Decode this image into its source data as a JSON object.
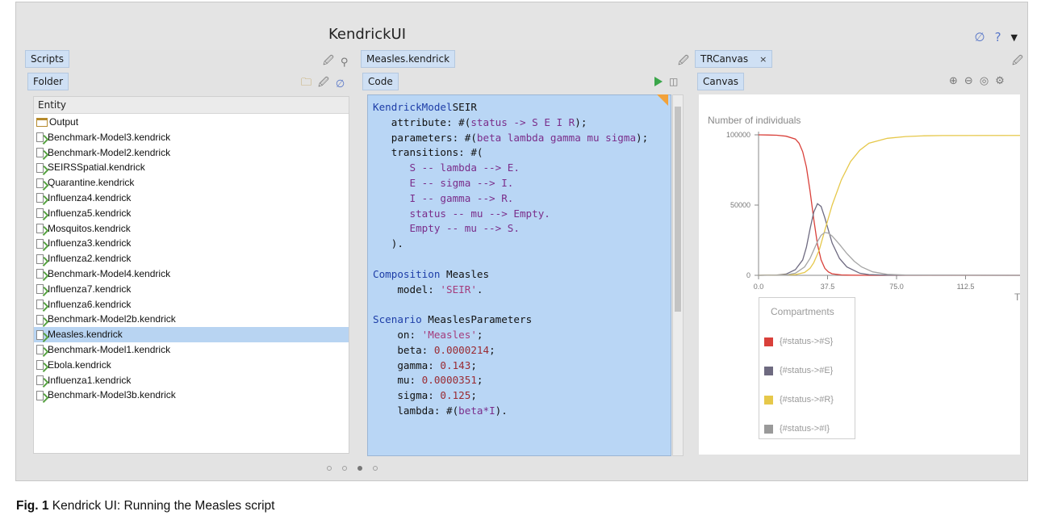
{
  "app": {
    "title": "KendrickUI"
  },
  "left_pane": {
    "tab": "Scripts",
    "subtab": "Folder",
    "column_header": "Entity",
    "items": [
      {
        "label": "Output",
        "kind": "folder"
      },
      {
        "label": "Benchmark-Model3.kendrick",
        "kind": "file"
      },
      {
        "label": "Benchmark-Model2.kendrick",
        "kind": "file"
      },
      {
        "label": "SEIRSSpatial.kendrick",
        "kind": "file"
      },
      {
        "label": "Quarantine.kendrick",
        "kind": "file"
      },
      {
        "label": "Influenza4.kendrick",
        "kind": "file"
      },
      {
        "label": "Influenza5.kendrick",
        "kind": "file"
      },
      {
        "label": "Mosquitos.kendrick",
        "kind": "file"
      },
      {
        "label": "Influenza3.kendrick",
        "kind": "file"
      },
      {
        "label": "Influenza2.kendrick",
        "kind": "file"
      },
      {
        "label": "Benchmark-Model4.kendrick",
        "kind": "file"
      },
      {
        "label": "Influenza7.kendrick",
        "kind": "file"
      },
      {
        "label": "Influenza6.kendrick",
        "kind": "file"
      },
      {
        "label": "Benchmark-Model2b.kendrick",
        "kind": "file"
      },
      {
        "label": "Measles.kendrick",
        "kind": "file",
        "selected": true
      },
      {
        "label": "Benchmark-Model1.kendrick",
        "kind": "file"
      },
      {
        "label": "Ebola.kendrick",
        "kind": "file"
      },
      {
        "label": "Influenza1.kendrick",
        "kind": "file"
      },
      {
        "label": "Benchmark-Model3b.kendrick",
        "kind": "file"
      }
    ]
  },
  "middle_pane": {
    "tab": "Measles.kendrick",
    "subtab": "Code",
    "code_lines": [
      [
        [
          "kw",
          "KendrickModel"
        ],
        [
          "",
          "SEIR"
        ]
      ],
      [
        [
          "",
          "   attribute: #("
        ],
        [
          "sym",
          "status -> S E I R"
        ],
        [
          "",
          ");"
        ]
      ],
      [
        [
          "",
          "   parameters: #("
        ],
        [
          "sym",
          "beta lambda gamma mu sigma"
        ],
        [
          "",
          ");"
        ]
      ],
      [
        [
          "",
          "   transitions: #("
        ]
      ],
      [
        [
          "sym",
          "      S -- lambda --> E."
        ]
      ],
      [
        [
          "sym",
          "      E -- sigma --> I."
        ]
      ],
      [
        [
          "sym",
          "      I -- gamma --> R."
        ]
      ],
      [
        [
          "sym",
          "      status -- mu --> Empty."
        ]
      ],
      [
        [
          "sym",
          "      Empty -- mu --> S."
        ]
      ],
      [
        [
          "",
          "   )."
        ]
      ],
      [
        [
          "",
          ""
        ]
      ],
      [
        [
          "kw",
          "Composition"
        ],
        [
          "",
          " Measles"
        ]
      ],
      [
        [
          "",
          "    model: "
        ],
        [
          "str",
          "'SEIR'"
        ],
        [
          "",
          "."
        ]
      ],
      [
        [
          "",
          ""
        ]
      ],
      [
        [
          "kw",
          "Scenario"
        ],
        [
          "",
          " MeaslesParameters"
        ]
      ],
      [
        [
          "",
          "    on: "
        ],
        [
          "str",
          "'Measles'"
        ],
        [
          "",
          ";"
        ]
      ],
      [
        [
          "",
          "    beta: "
        ],
        [
          "num",
          "0.0000214"
        ],
        [
          "",
          ";"
        ]
      ],
      [
        [
          "",
          "    gamma: "
        ],
        [
          "num",
          "0.143"
        ],
        [
          "",
          ";"
        ]
      ],
      [
        [
          "",
          "    mu: "
        ],
        [
          "num",
          "0.0000351"
        ],
        [
          "",
          ";"
        ]
      ],
      [
        [
          "",
          "    sigma: "
        ],
        [
          "num",
          "0.125"
        ],
        [
          "",
          ";"
        ]
      ],
      [
        [
          "",
          "    lambda: #("
        ],
        [
          "sym",
          "beta*I"
        ],
        [
          "",
          ")."
        ]
      ]
    ]
  },
  "right_pane": {
    "tab": "TRCanvas",
    "tab_close": "×",
    "subtab": "Canvas",
    "legend_title": "Compartments",
    "legend": [
      {
        "label": "{#status->#S}",
        "color": "#d9403a"
      },
      {
        "label": "{#status->#E}",
        "color": "#6e6a80"
      },
      {
        "label": "{#status->#R}",
        "color": "#e6c84a"
      },
      {
        "label": "{#status->#I}",
        "color": "#9a9a9a"
      }
    ]
  },
  "chart_data": {
    "type": "line",
    "ylabel": "Number of individuals",
    "xlabel": "T",
    "x_ticks": [
      "0.0",
      "37.5",
      "75.0",
      "112.5"
    ],
    "y_ticks": [
      "0",
      "50000",
      "100000"
    ],
    "xlim": [
      0,
      150
    ],
    "ylim": [
      0,
      100000
    ],
    "series": [
      {
        "name": "{#status->#S}",
        "color": "#d9403a",
        "x": [
          0,
          5,
          10,
          15,
          20,
          22,
          24,
          26,
          28,
          30,
          32,
          34,
          36,
          38,
          40,
          45,
          50,
          60,
          150
        ],
        "y": [
          100000,
          99900,
          99700,
          99000,
          97000,
          94000,
          88000,
          77000,
          60000,
          40000,
          22000,
          11000,
          5000,
          2400,
          1100,
          300,
          100,
          20,
          0
        ]
      },
      {
        "name": "{#status->#E}",
        "color": "#6e6a80",
        "x": [
          0,
          10,
          15,
          20,
          24,
          26,
          28,
          30,
          32,
          34,
          36,
          38,
          40,
          44,
          48,
          55,
          60,
          70,
          150
        ],
        "y": [
          0,
          200,
          900,
          4000,
          11000,
          20000,
          33000,
          45000,
          51000,
          49000,
          41000,
          32000,
          23000,
          12000,
          6000,
          1500,
          500,
          100,
          0
        ]
      },
      {
        "name": "{#status->#R}",
        "color": "#e6c84a",
        "x": [
          0,
          20,
          25,
          28,
          30,
          33,
          36,
          40,
          45,
          50,
          55,
          60,
          70,
          80,
          90,
          100,
          150
        ],
        "y": [
          0,
          500,
          2000,
          5000,
          9000,
          18000,
          32000,
          50000,
          68000,
          81000,
          89000,
          94000,
          97500,
          98800,
          99300,
          99500,
          99600
        ]
      },
      {
        "name": "{#status->#I}",
        "color": "#a5a5a5",
        "x": [
          0,
          15,
          20,
          25,
          28,
          30,
          32,
          34,
          36,
          38,
          40,
          44,
          48,
          52,
          56,
          62,
          70,
          80,
          150
        ],
        "y": [
          0,
          300,
          1500,
          6000,
          12000,
          18000,
          24000,
          28500,
          30500,
          30000,
          28000,
          22000,
          15500,
          10000,
          6000,
          2500,
          700,
          150,
          0
        ]
      }
    ]
  }
}
